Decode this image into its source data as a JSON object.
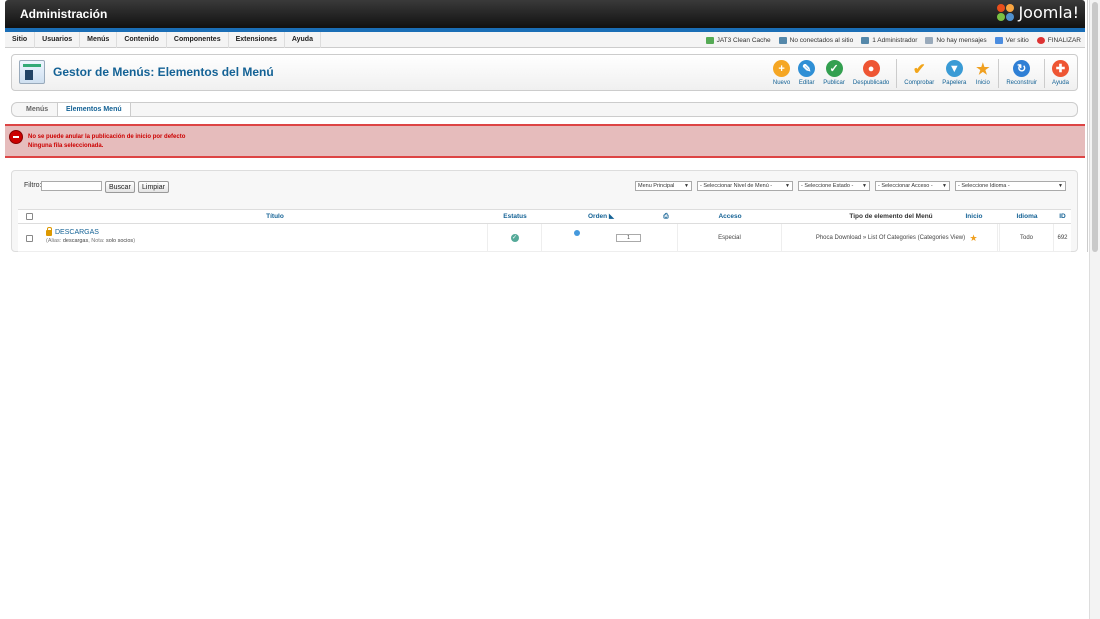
{
  "header": {
    "title": "Administración",
    "logo_text": "Joomla!"
  },
  "menu": [
    "Sitio",
    "Usuarios",
    "Menús",
    "Contenido",
    "Componentes",
    "Extensiones",
    "Ayuda"
  ],
  "status": [
    {
      "label": "JAT3 Clean Cache",
      "icon": "cache-icon",
      "color": "#5a5"
    },
    {
      "label": "No conectados al sitio",
      "icon": "users-icon",
      "color": "#58a"
    },
    {
      "label": "1 Administrador",
      "icon": "admin-icon",
      "color": "#58a"
    },
    {
      "label": "No hay mensajes",
      "icon": "messages-icon",
      "color": "#9ab"
    },
    {
      "label": "Ver sitio",
      "icon": "view-site-icon",
      "color": "#4b8de0"
    },
    {
      "label": "FINALIZAR",
      "icon": "logout-icon",
      "color": "#d33"
    }
  ],
  "page": {
    "title": "Gestor de Menús: Elementos del Menú"
  },
  "toolbar": [
    {
      "label": "Nuevo",
      "icon": "new-icon",
      "glyph": "+",
      "color": "#f5a623"
    },
    {
      "label": "Editar",
      "icon": "edit-icon",
      "glyph": "✎",
      "color": "#2f8fd5"
    },
    {
      "label": "Publicar",
      "icon": "publish-icon",
      "glyph": "✓",
      "color": "#33a050"
    },
    {
      "label": "Despublicado",
      "icon": "unpublish-icon",
      "glyph": "●",
      "color": "#e53"
    },
    {
      "label": "Comprobar",
      "icon": "check-in-icon",
      "glyph": "✔",
      "color": "#f2a51a"
    },
    {
      "label": "Papelera",
      "icon": "trash-icon",
      "glyph": "▼",
      "color": "#3a9bd5"
    },
    {
      "label": "Inicio",
      "icon": "home-star-icon",
      "glyph": "★",
      "color": "#f0a020"
    },
    {
      "label": "Reconstruir",
      "icon": "rebuild-icon",
      "glyph": "↻",
      "color": "#2f7fd5"
    },
    {
      "label": "Ayuda",
      "icon": "help-icon",
      "glyph": "✚",
      "color": "#e53"
    }
  ],
  "subnav": {
    "menus": "Menús",
    "items": "Elementos Menú"
  },
  "alert": {
    "line1": "No se puede anular la publicación de inicio por defecto",
    "line2": "Ninguna fila seleccionada."
  },
  "filter": {
    "label": "Filtro:",
    "value": "",
    "search": "Buscar",
    "clear": "Limpiar"
  },
  "selects": [
    "Menu Principal",
    "- Seleccionar Nivel de Menú -",
    "- Seleccione Estado -",
    "- Seleccionar Acceso -",
    "- Seleccione Idioma -"
  ],
  "columns": {
    "title": "Título",
    "status": "Estatus",
    "order": "Orden",
    "access": "Acceso",
    "type": "Tipo de elemento del Menú",
    "home": "Inicio",
    "language": "Idioma",
    "id": "ID"
  },
  "rows": [
    {
      "title": "DESCARGAS",
      "alias_label": "Alias:",
      "alias": "descargas",
      "note_label": "Nota:",
      "note": "solo socios",
      "order": "1",
      "access": "Especial",
      "type": "Phoca Download » List Of Categories (Categories View)",
      "language": "Todo",
      "id": "692"
    }
  ]
}
